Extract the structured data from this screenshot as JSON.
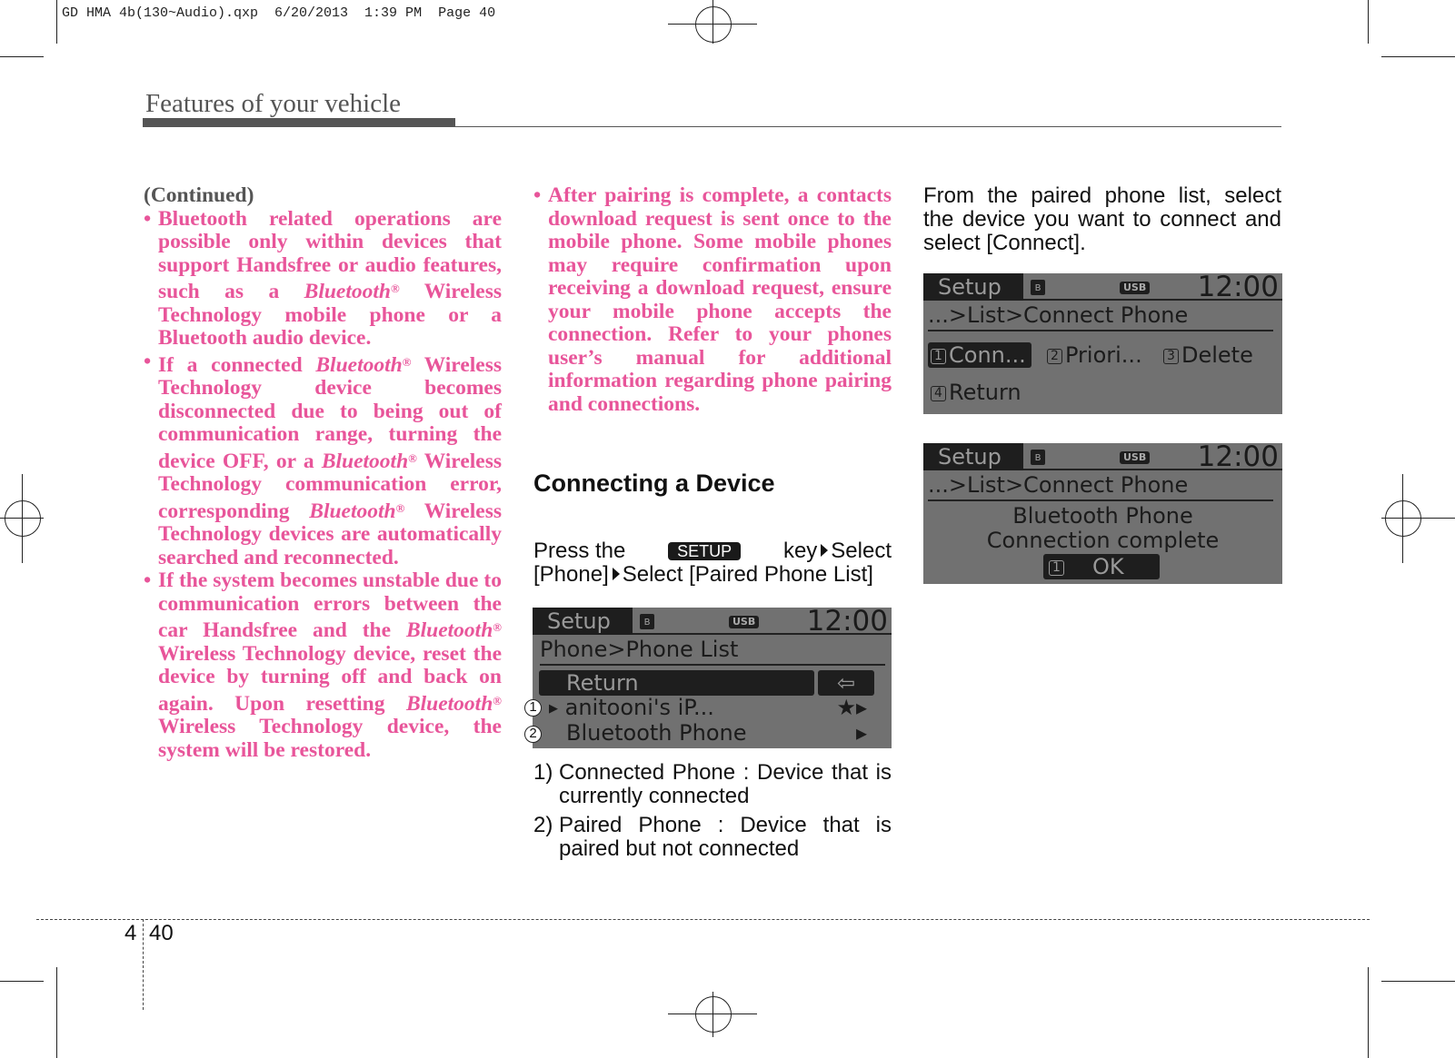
{
  "slug": "GD HMA 4b(130~Audio).qxp  6/20/2013  1:39 PM  Page 40",
  "header": {
    "section_title": "Features of your vehicle"
  },
  "left_column": {
    "continued": "(Continued)",
    "bullets": [
      [
        [
          "Bluetooth related operations are possible only within devices that support Handsfree or audio features, such as a ",
          ""
        ],
        [
          "Bluetooth",
          "i"
        ],
        [
          "®",
          "s"
        ],
        [
          " Wireless Technology mobile phone or a Bluetooth audio device.",
          ""
        ]
      ],
      [
        [
          "If a connected ",
          ""
        ],
        [
          "Bluetooth",
          "i"
        ],
        [
          "®",
          "s"
        ],
        [
          " Wireless Technology device becomes disconnected due to being out of communication range, turning the device OFF, or a ",
          ""
        ],
        [
          "Bluetooth",
          "i"
        ],
        [
          "®",
          "s"
        ],
        [
          " Wireless Technology communication error, corresponding ",
          ""
        ],
        [
          "Bluetooth",
          "i"
        ],
        [
          "®",
          "s"
        ],
        [
          " Wireless Technology devices are automatically searched and reconnected.",
          ""
        ]
      ],
      [
        [
          "If the system becomes unstable due to communication errors between the car Handsfree and the ",
          ""
        ],
        [
          "Bluetooth",
          "i"
        ],
        [
          "®",
          "s"
        ],
        [
          " Wireless Technology device, reset the device by turning off and back on again. Upon resetting ",
          ""
        ],
        [
          "Bluetooth",
          "i"
        ],
        [
          "®",
          "s"
        ],
        [
          " Wireless Technology device, the system will be restored.",
          ""
        ]
      ]
    ]
  },
  "middle_column": {
    "bullet": "After pairing is complete, a contacts download request is sent once to the mobile phone. Some mobile phones may require confirmation upon receiving a download request, ensure your mobile phone accepts the connection. Refer to your phones user’s manual for additional information regarding phone pairing and connections.",
    "heading": "Connecting a Device",
    "instr_press": "Press the",
    "setup_key": "SETUP",
    "instr_key": "key",
    "instr_select1": "Select",
    "instr_phone": "[Phone]",
    "instr_select2": "Select [Paired Phone List]",
    "screen": {
      "title": "Setup",
      "bt_icon": "bluetooth-icon",
      "usb": "USB",
      "clock": "12:00",
      "path": "Phone>Phone List",
      "return": "Return",
      "return_icon": "⇦",
      "item1": "anitooni's iP...",
      "item1_icon": "★▸",
      "item2": "Bluetooth Phone",
      "item2_icon": "▸",
      "marker1": "1",
      "marker2": "2"
    },
    "notes": [
      {
        "num": "1)",
        "text": "Connected Phone : Device that is currently connected"
      },
      {
        "num": "2)",
        "text": "Paired Phone : Device that is paired but not connected"
      }
    ]
  },
  "right_column": {
    "intro": "From the paired phone list, select the device you want to connect and select [Connect].",
    "screen1": {
      "title": "Setup",
      "usb": "USB",
      "clock": "12:00",
      "path": "...>List>Connect Phone",
      "options": [
        {
          "num": "1",
          "label": "Conn..."
        },
        {
          "num": "2",
          "label": "Priori..."
        },
        {
          "num": "3",
          "label": "Delete"
        },
        {
          "num": "4",
          "label": "Return"
        }
      ]
    },
    "screen2": {
      "title": "Setup",
      "usb": "USB",
      "clock": "12:00",
      "path": "...>List>Connect Phone",
      "message_line1": "Bluetooth Phone",
      "message_line2": "Connection complete",
      "ok_num": "1",
      "ok_label": "OK"
    }
  },
  "footer": {
    "chapter": "4",
    "page": "40"
  },
  "colors": {
    "accent_pink": "#e8559a",
    "heading_gray": "#555555",
    "lcd_background": "#717171"
  }
}
